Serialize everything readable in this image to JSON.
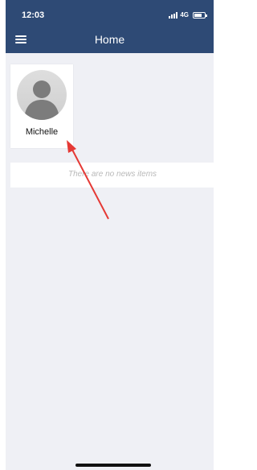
{
  "status_bar": {
    "time": "12:03",
    "network": "4G"
  },
  "header": {
    "title": "Home",
    "menu_icon": "hamburger-icon"
  },
  "profile": {
    "name": "Michelle",
    "avatar_icon": "default-user-avatar"
  },
  "news": {
    "empty_message": "There are no news items"
  },
  "colors": {
    "header_bg": "#2e4a75",
    "page_bg": "#eff0f5",
    "annotation_arrow": "#e53935"
  }
}
